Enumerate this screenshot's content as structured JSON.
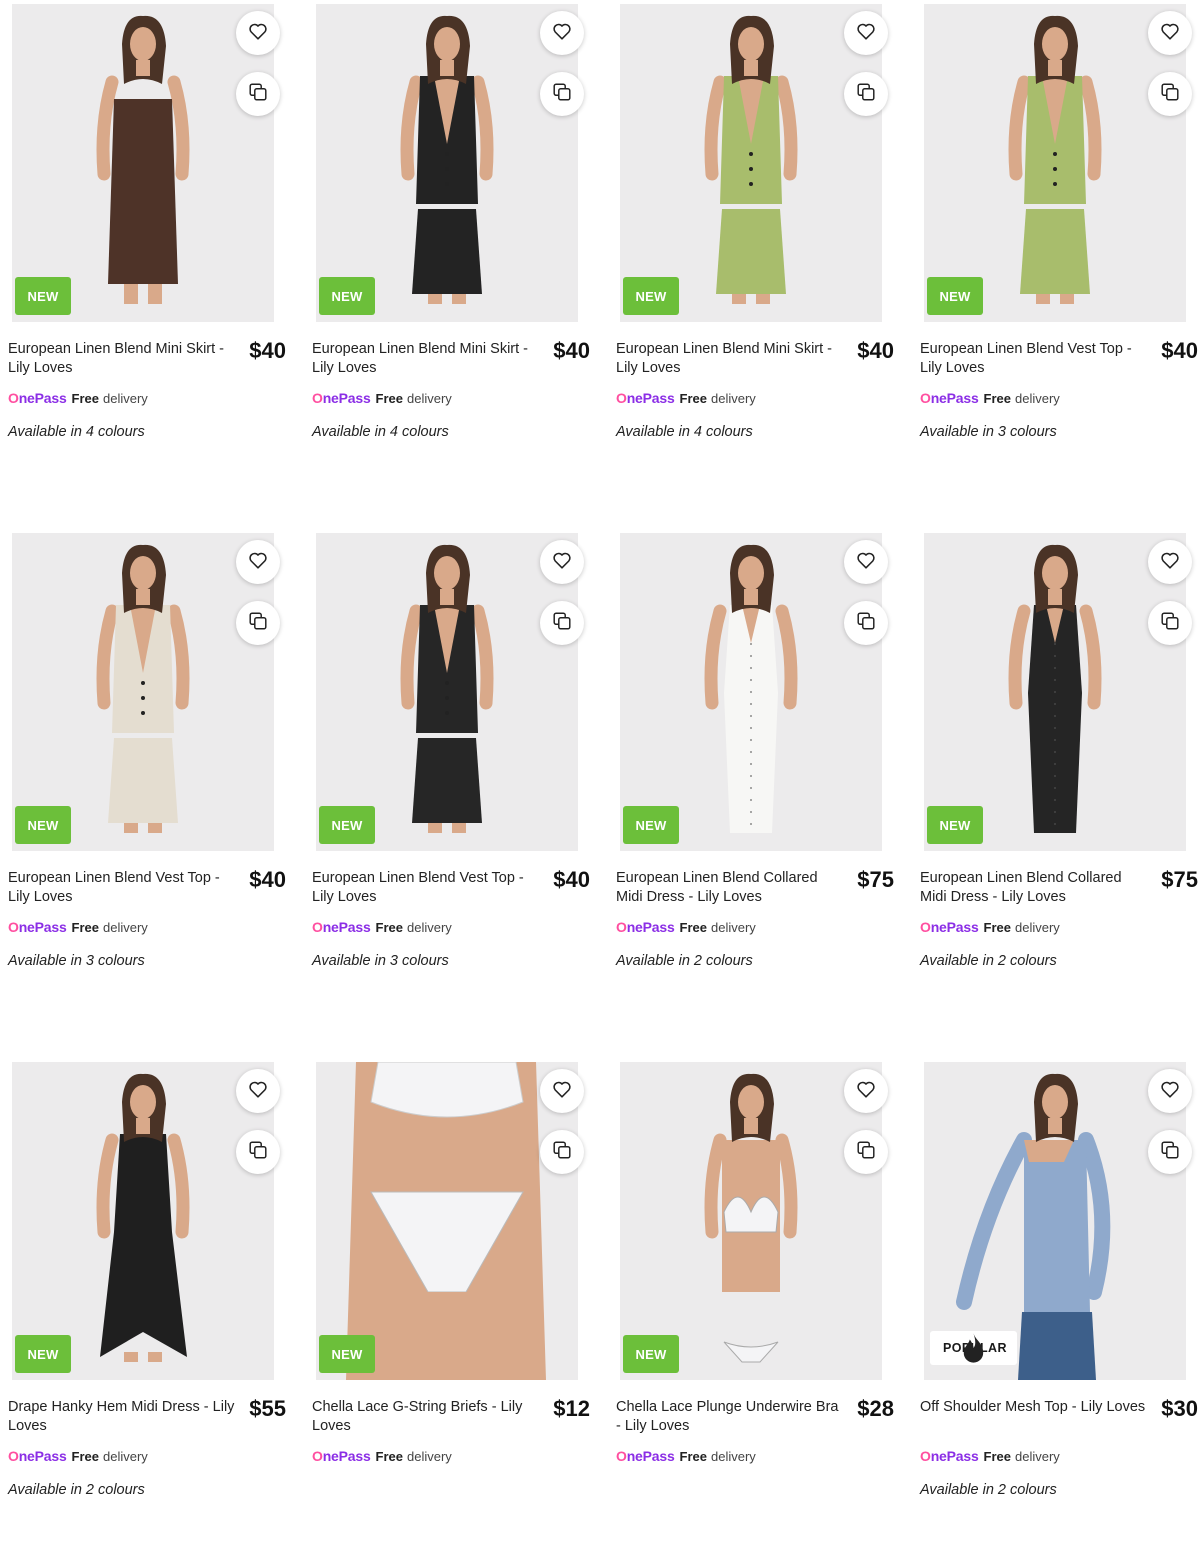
{
  "ui": {
    "new_badge": "NEW",
    "popular_badge": "POPULAR",
    "onepass_label": "OnePass",
    "free_label": "Free",
    "delivery_label": "delivery",
    "icons": {
      "favourite": "heart-outline-icon",
      "compare": "compare-squares-icon",
      "popular": "flame-icon"
    }
  },
  "products": [
    {
      "title": "European Linen Blend Mini Skirt - Lily Loves",
      "price": "$40",
      "colours": "Available in 4 colours",
      "badge": "NEW",
      "outfit": "#4e3328",
      "garment": "strapless-skirt"
    },
    {
      "title": "European Linen Blend Mini Skirt - Lily Loves",
      "price": "$40",
      "colours": "Available in 4 colours",
      "badge": "NEW",
      "outfit": "#232323",
      "garment": "vest-skirt"
    },
    {
      "title": "European Linen Blend Mini Skirt - Lily Loves",
      "price": "$40",
      "colours": "Available in 4 colours",
      "badge": "NEW",
      "outfit": "#a8bd6c",
      "garment": "vest-skirt"
    },
    {
      "title": "European Linen Blend Vest Top - Lily Loves",
      "price": "$40",
      "colours": "Available in 3 colours",
      "badge": "NEW",
      "outfit": "#a8bd6c",
      "garment": "vest-skirt"
    },
    {
      "title": "European Linen Blend Vest Top - Lily Loves",
      "price": "$40",
      "colours": "Available in 3 colours",
      "badge": "NEW",
      "outfit": "#e4ddd0",
      "garment": "vest-skirt"
    },
    {
      "title": "European Linen Blend Vest Top - Lily Loves",
      "price": "$40",
      "colours": "Available in 3 colours",
      "badge": "NEW",
      "outfit": "#262626",
      "garment": "vest-skirt"
    },
    {
      "title": "European Linen Blend Collared Midi Dress - Lily Loves",
      "price": "$75",
      "colours": "Available in 2 colours",
      "badge": "NEW",
      "outfit": "#f7f7f5",
      "garment": "midi-dress"
    },
    {
      "title": "European Linen Blend Collared Midi Dress - Lily Loves",
      "price": "$75",
      "colours": "Available in 2 colours",
      "badge": "NEW",
      "outfit": "#252525",
      "garment": "midi-dress"
    },
    {
      "title": "Drape Hanky Hem Midi Dress - Lily Loves",
      "price": "$55",
      "colours": "Available in 2 colours",
      "badge": "NEW",
      "outfit": "#1f1f1f",
      "garment": "hanky-dress"
    },
    {
      "title": "Chella Lace G-String Briefs - Lily Loves",
      "price": "$12",
      "colours": "",
      "badge": "NEW",
      "outfit": "#f4f4f6",
      "garment": "briefs"
    },
    {
      "title": "Chella Lace Plunge Underwire Bra - Lily Loves",
      "price": "$28",
      "colours": "",
      "badge": "NEW",
      "outfit": "#f4f4f6",
      "garment": "bra"
    },
    {
      "title": "Off Shoulder Mesh Top - Lily Loves",
      "price": "$30",
      "colours": "Available in 2 colours",
      "badge": "POPULAR",
      "outfit": "#8fa9cc",
      "garment": "mesh-top"
    }
  ]
}
